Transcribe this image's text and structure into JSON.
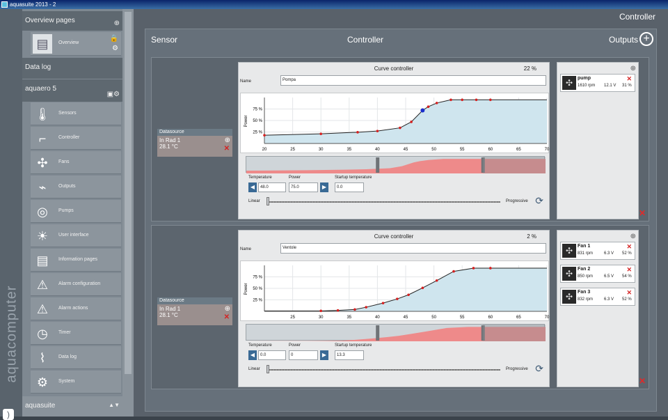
{
  "window": {
    "title": "aquasuite 2013 - 2"
  },
  "brand": {
    "text": "aquacomputer"
  },
  "sidebar": {
    "sections": [
      {
        "label": "Overview pages"
      },
      {
        "label": "Data log"
      },
      {
        "label": "aquaero 5"
      },
      {
        "label": "aquasuite"
      }
    ],
    "overview_item": {
      "label": "Overview"
    },
    "items": [
      {
        "label": "Sensors",
        "icon": "thermometer-icon",
        "glyph": "🌡"
      },
      {
        "label": "Controller",
        "icon": "controller-icon",
        "glyph": "⌐"
      },
      {
        "label": "Fans",
        "icon": "fan-icon",
        "glyph": "✣"
      },
      {
        "label": "Outputs",
        "icon": "plug-icon",
        "glyph": "⌁"
      },
      {
        "label": "Pumps",
        "icon": "pump-icon",
        "glyph": "◎"
      },
      {
        "label": "User interface",
        "icon": "brightness-icon",
        "glyph": "☀"
      },
      {
        "label": "Information pages",
        "icon": "pages-icon",
        "glyph": "▤"
      },
      {
        "label": "Alarm configuration",
        "icon": "alarm-icon",
        "glyph": "⚠"
      },
      {
        "label": "Alarm actions",
        "icon": "alarm-actions-icon",
        "glyph": "⚠"
      },
      {
        "label": "Timer",
        "icon": "timer-icon",
        "glyph": "◷"
      },
      {
        "label": "Data log",
        "icon": "datalog-icon",
        "glyph": "⌇"
      },
      {
        "label": "System",
        "icon": "gear-icon",
        "glyph": "⚙"
      }
    ]
  },
  "page": {
    "title": "Controller"
  },
  "headers": {
    "sensor": "Sensor",
    "controller": "Controller",
    "outputs": "Outputs"
  },
  "blocks": [
    {
      "datasource": {
        "header": "Datasource",
        "source": "In Rad 1",
        "value": "28.1 °C"
      },
      "controller": {
        "title": "Curve controller",
        "percent": "22 %",
        "name_label": "Name",
        "name": "Pompa",
        "temperature_label": "Temperature",
        "temperature": "48.0",
        "power_label": "Power",
        "power": "75.0",
        "startup_label": "Startup temperature",
        "startup": "0.0",
        "linear_label": "Linear",
        "progressive_label": "Progressive",
        "y_label": "Power"
      },
      "outputs": [
        {
          "name": "pump",
          "rpm": "1610 rpm",
          "voltage": "12.1 V",
          "percent": "31 %"
        }
      ]
    },
    {
      "datasource": {
        "header": "Datasource",
        "source": "In Rad 1",
        "value": "28.1 °C"
      },
      "controller": {
        "title": "Curve controller",
        "percent": "2 %",
        "name_label": "Name",
        "name": "Ventole",
        "temperature_label": "Temperature",
        "temperature": "0.0",
        "power_label": "Power",
        "power": "0",
        "startup_label": "Startup temperature",
        "startup": "13.3",
        "linear_label": "Linear",
        "progressive_label": "Progressive",
        "y_label": "Power"
      },
      "outputs": [
        {
          "name": "Fan 1",
          "rpm": "831 rpm",
          "voltage": "6.3 V",
          "percent": "52 %"
        },
        {
          "name": "Fan 2",
          "rpm": "850 rpm",
          "voltage": "6.5 V",
          "percent": "54 %"
        },
        {
          "name": "Fan 3",
          "rpm": "832 rpm",
          "voltage": "6.3 V",
          "percent": "52 %"
        }
      ]
    }
  ],
  "chart_data": [
    {
      "type": "line",
      "ylabel": "Power",
      "xlim": [
        20,
        70
      ],
      "ylim": [
        0,
        100
      ],
      "x_ticks": [
        "20",
        "25",
        "30",
        "35",
        "40",
        "45",
        "50",
        "55",
        "60",
        "65",
        "70"
      ],
      "y_ticks": [
        "25 %",
        "50 %",
        "75 %"
      ],
      "x": [
        20,
        30,
        36.5,
        40,
        44,
        46,
        48,
        49,
        50.5,
        53,
        55,
        57.5,
        60
      ],
      "y": [
        18,
        21,
        24.5,
        27,
        34,
        47,
        72,
        80,
        88,
        95,
        95,
        95,
        95
      ],
      "highlight_x": 48,
      "highlight_y": 72
    },
    {
      "type": "line",
      "ylabel": "Power",
      "xlim": [
        20,
        70
      ],
      "ylim": [
        0,
        100
      ],
      "x_ticks": [
        "25",
        "30",
        "35",
        "40",
        "45",
        "50",
        "55",
        "60",
        "65",
        "70"
      ],
      "y_ticks": [
        "25 %",
        "50 %",
        "75 %"
      ],
      "x": [
        30,
        33,
        36,
        38,
        41,
        43.5,
        45.5,
        48,
        50.5,
        53.5,
        57,
        60
      ],
      "y": [
        1,
        2,
        4,
        9,
        18,
        27,
        36,
        51,
        67,
        87,
        94,
        94
      ]
    }
  ]
}
